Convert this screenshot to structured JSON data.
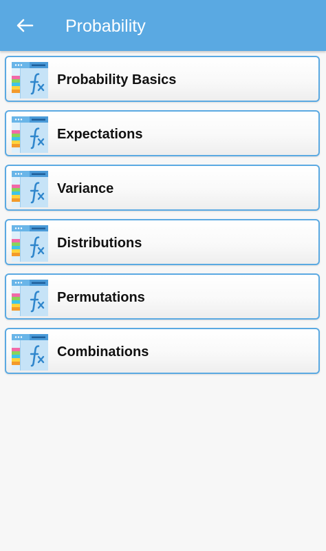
{
  "app_bar": {
    "title": "Probability",
    "background": "#5aa9e2",
    "back_icon": "arrow-left-icon"
  },
  "topics": [
    {
      "label": "Probability Basics",
      "icon": "formula-icon"
    },
    {
      "label": "Expectations",
      "icon": "formula-icon"
    },
    {
      "label": "Variance",
      "icon": "formula-icon"
    },
    {
      "label": "Distributions",
      "icon": "formula-icon"
    },
    {
      "label": "Permutations",
      "icon": "formula-icon"
    },
    {
      "label": "Combinations",
      "icon": "formula-icon"
    }
  ],
  "colors": {
    "accent": "#5aa9e2",
    "item_border": "#5aa9e2",
    "text": "#111111",
    "background": "#f7f7f7"
  }
}
